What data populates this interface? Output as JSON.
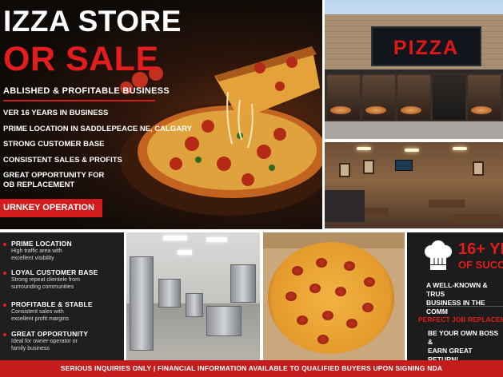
{
  "hero": {
    "title_line1": "IZZA STORE",
    "title_line2": "OR SALE",
    "subtitle": "ABLISHED & PROFITABLE BUSINESS",
    "bullets": [
      "VER 16 YEARS IN BUSINESS",
      "PRIME LOCATION IN SADDLEPEACE NE, CALGARY",
      "STRONG CUSTOMER BASE",
      "CONSISTENT SALES & PROFITS",
      "GREAT OPPORTUNITY FOR\nOB REPLACEMENT"
    ],
    "cta": "URNKEY OPERATION"
  },
  "storefront": {
    "sign_text": "PIZZA"
  },
  "features": [
    {
      "title": "PRIME LOCATION",
      "desc": "High traffic area with\nexcellent visibility"
    },
    {
      "title": "LOYAL CUSTOMER BASE",
      "desc": "Strong repeat clientele from\nsurrounding communities"
    },
    {
      "title": "PROFITABLE & STABLE",
      "desc": "Consistent sales with\nexcellent profit margins"
    },
    {
      "title": "GREAT OPPORTUNITY",
      "desc": "Ideal for owner-operator or\nfamily business"
    }
  ],
  "years": {
    "big": "16+ YEA",
    "big2": "OF SUCC",
    "mid": "A WELL-KNOWN & TRUS\nBUSINESS IN THE COMM",
    "red": "PERFECT JOB REPLACEM",
    "bottom": "BE YOUR OWN BOSS &\nEARN GREAT RETURN!"
  },
  "footer": "SERIOUS INQUIRIES ONLY  |  FINANCIAL INFORMATION AVAILABLE TO QUALIFIED BUYERS UPON SIGNING NDA",
  "colors": {
    "accent_red": "#d21c1c",
    "dark_bg": "#1c1c1c"
  }
}
